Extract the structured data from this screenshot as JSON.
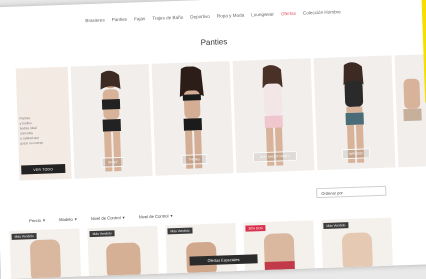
{
  "nav": {
    "items": [
      "Brasieres",
      "Panties",
      "Fajas",
      "Trajes de Baño",
      "Deportivo",
      "Ropa y Moda",
      "Loungwear",
      "Ofertas",
      "Colección Hombre"
    ],
    "active_index": 7
  },
  "page_title": "Panties",
  "promo": {
    "text_lines": [
      "Panties",
      "y bodies",
      "bodies ideal",
      "cómodos",
      "y calidad que",
      "gozar su cuerpo"
    ],
    "button_label": "VER TODO"
  },
  "carousel": [
    {
      "label": "BRIEF"
    },
    {
      "label": "THONG"
    },
    {
      "label": "BOY SHORT PANTY"
    },
    {
      "label": "HIPSTER"
    }
  ],
  "filters": [
    {
      "label": "Precio"
    },
    {
      "label": "Modelo"
    },
    {
      "label": "Nivel de Control"
    },
    {
      "label": "Nivel de Control"
    }
  ],
  "sort_placeholder": "Ordenar por",
  "products": [
    {
      "badge": "Más Vendido",
      "badge_color": "#3b3b3b"
    },
    {
      "badge": "Más Vendido",
      "badge_color": "#3b3b3b"
    },
    {
      "badge": "Más Vendido",
      "badge_color": "#3b3b3b"
    },
    {
      "badge": "30% Dcto",
      "badge_color": "#d9324e"
    },
    {
      "badge": "Más Vendido",
      "badge_color": "#3b3b3b"
    }
  ],
  "offer_button": "Ofertas Especiales",
  "colors": {
    "accent": "#e05a6f",
    "highlight": "#f6df00"
  }
}
